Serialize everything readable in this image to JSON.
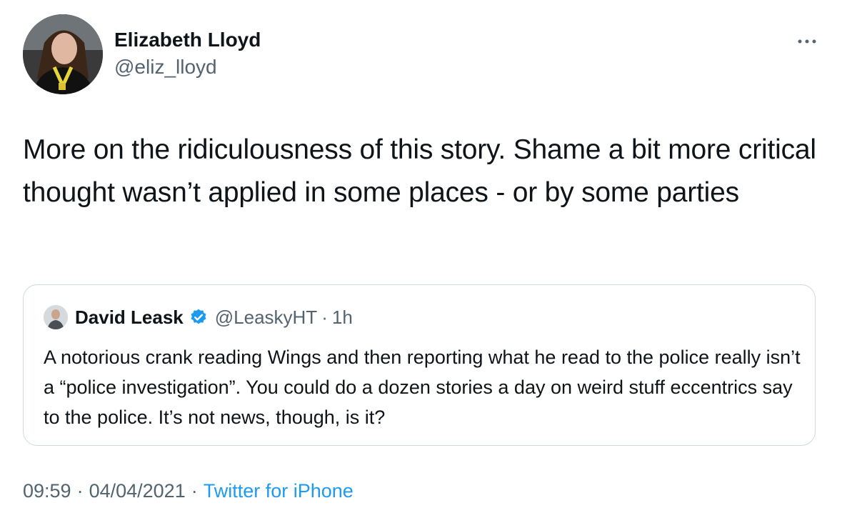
{
  "author": {
    "name": "Elizabeth Lloyd",
    "handle": "@eliz_lloyd"
  },
  "more_icon": "more-horizontal-icon",
  "tweet": {
    "text": "More on the ridiculousness of this story. Shame a bit more critical thought wasn’t applied in some places - or by some parties"
  },
  "quote": {
    "name": "David Leask",
    "verified_icon": "verified-badge-icon",
    "handle": "@LeaskyHT",
    "separator": "·",
    "time": "1h",
    "text": "A notorious crank reading Wings and then reporting what he read to the police really isn’t a “police investigation”.  You could do a dozen stories a day on weird stuff eccentrics  say to the police. It’s not news, though, is it?"
  },
  "meta": {
    "time": "09:59",
    "sep1": "·",
    "date": "04/04/2021",
    "sep2": "·",
    "source": "Twitter for iPhone"
  },
  "colors": {
    "accent": "#1d9bf0",
    "text": "#0f1419",
    "secondary": "#536471",
    "border": "#cfd9de"
  }
}
